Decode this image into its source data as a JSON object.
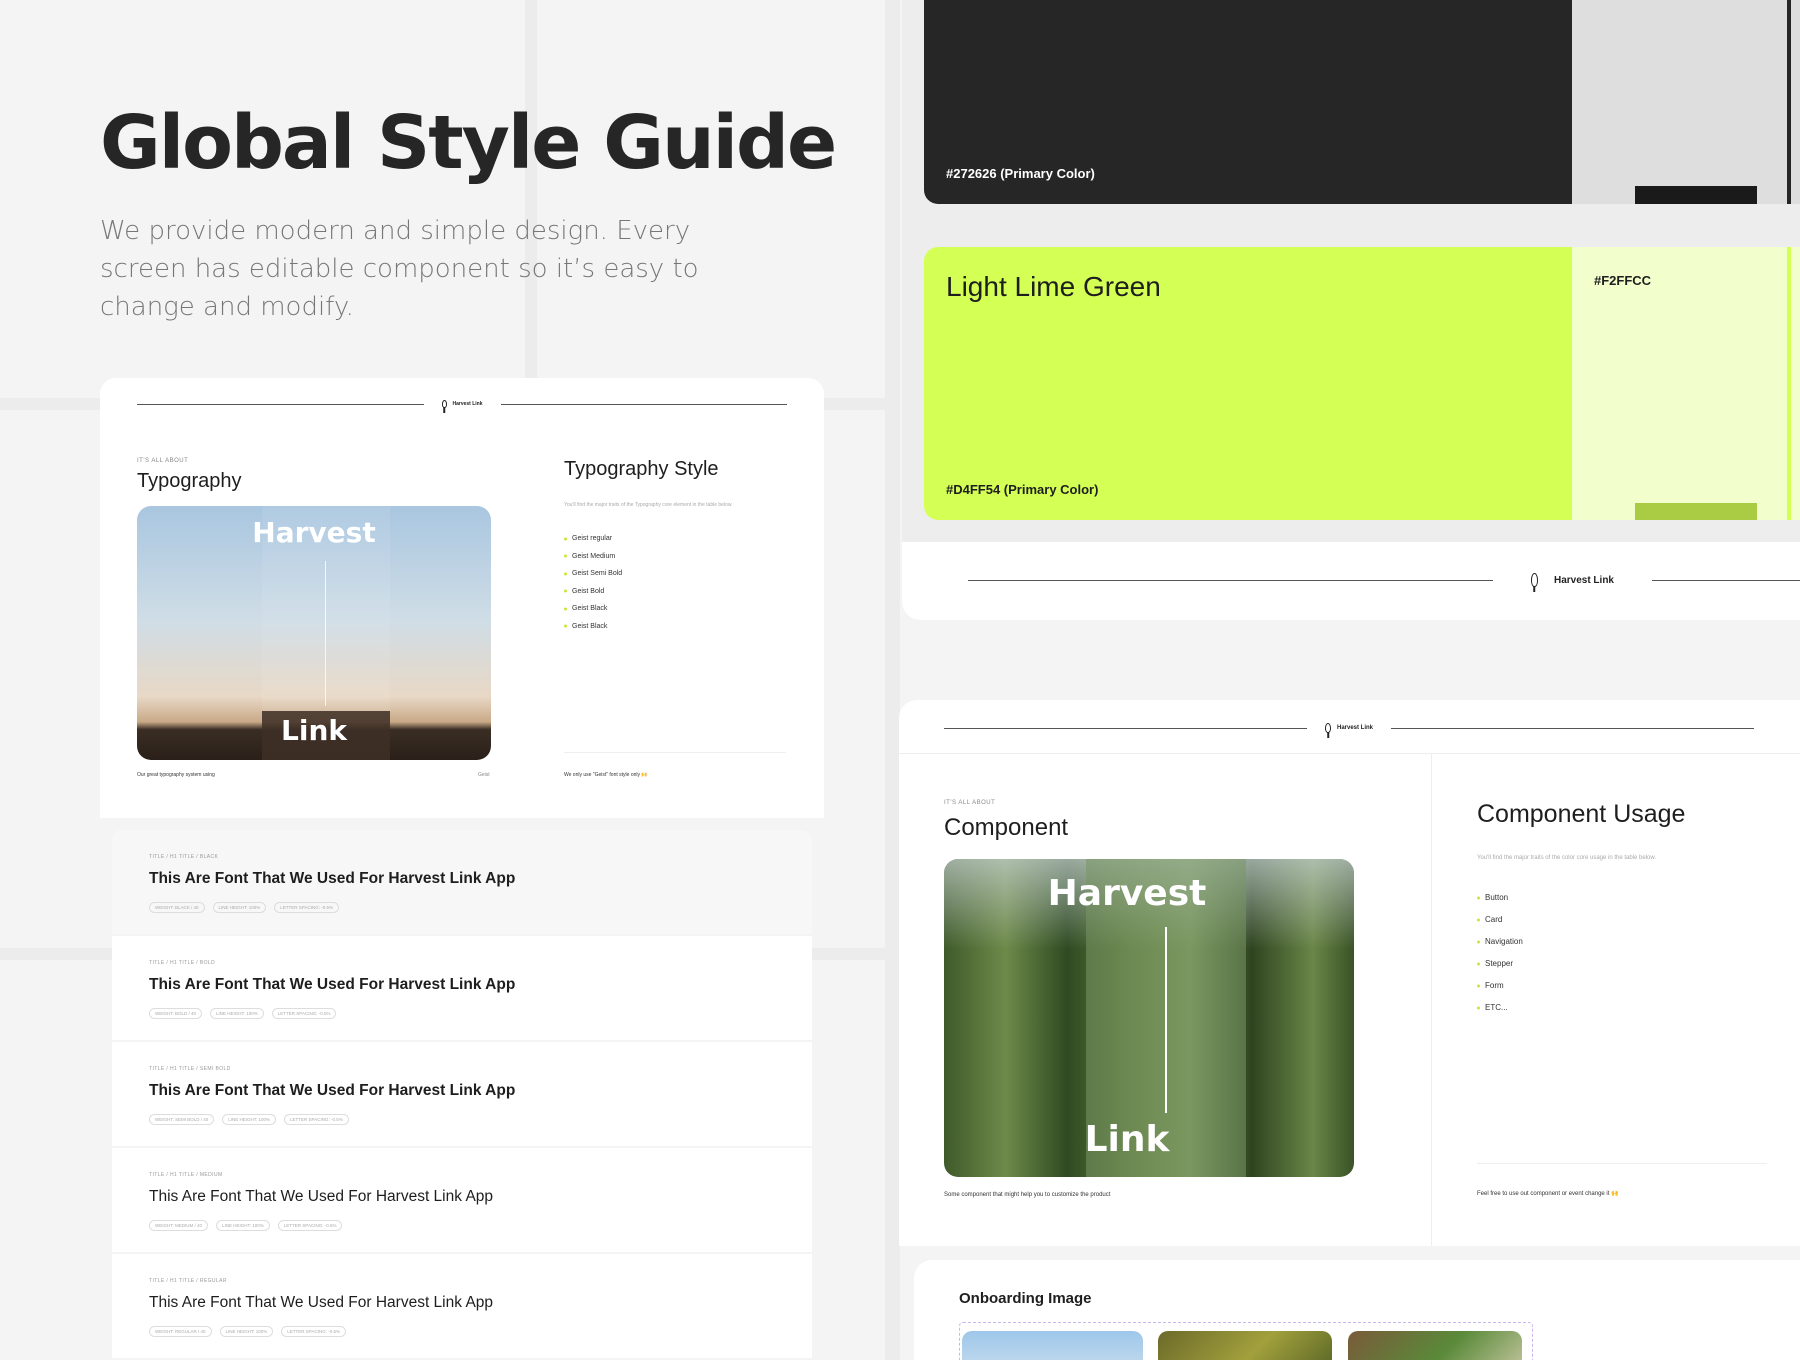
{
  "header": {
    "title": "Global Style Guide",
    "subtitle": "We provide modern and simple design. Every screen has editable component so it’s easy to change and modify."
  },
  "brand": {
    "name": "Harvest Link"
  },
  "typography_card": {
    "eyebrow": "IT'S ALL ABOUT",
    "title": "Typography",
    "photo_top": "Harvest",
    "photo_bottom": "Link",
    "caption_left": "Our great typography system using",
    "caption_right": "Geist",
    "style_title": "Typography Style",
    "style_desc": "You'll find the major traits of the Typography core element in the table below.",
    "items": [
      "Geist regular",
      "Geist Medium",
      "Geist Semi Bold",
      "Geist Bold",
      "Geist Black",
      "Geist Black"
    ],
    "footer_note": "We only use \"Geist\" font style only 🙌"
  },
  "font_rows": [
    {
      "cap": "TITLE / H1 TITLE / BLACK",
      "sample": "This Are Font That We Used For Harvest Link App",
      "tags": [
        "WEIGHT: BLACK / 40",
        "LINE HEIGHT: 100%",
        "LETTER SPACING: -0.5%"
      ],
      "weight": 800
    },
    {
      "cap": "TITLE / H1 TITLE / BOLD",
      "sample": "This Are Font That We Used For Harvest Link App",
      "tags": [
        "WEIGHT: BOLD / 40",
        "LINE HEIGHT: 100%",
        "LETTER SPACING: -0.5%"
      ],
      "weight": 700
    },
    {
      "cap": "TITLE / H1 TITLE / SEMI BOLD",
      "sample": "This Are Font That We Used For Harvest Link App",
      "tags": [
        "WEIGHT: SEMI BOLD / 40",
        "LINE HEIGHT: 100%",
        "LETTER SPACING: -0.5%"
      ],
      "weight": 600
    },
    {
      "cap": "TITLE / H1 TITLE / MEDIUM",
      "sample": "This Are Font That We Used For Harvest Link App",
      "tags": [
        "WEIGHT: MEDIUM / 40",
        "LINE HEIGHT: 100%",
        "LETTER SPACING: -0.5%"
      ],
      "weight": 500
    },
    {
      "cap": "TITLE / H1 TITLE / REGULAR",
      "sample": "This Are Font That We Used For Harvest Link App",
      "tags": [
        "WEIGHT: REGULAR / 40",
        "LINE HEIGHT: 100%",
        "LETTER SPACING: -0.5%"
      ],
      "weight": 400
    }
  ],
  "colors": {
    "primary_label": "#272626 (Primary Color)",
    "primary_hex": "#272626",
    "lime_name": "Light Lime Green",
    "lime_label": "#D4FF54 (Primary Color)",
    "lime_hex": "#D4FF54",
    "lime_light_label": "#F2FFCC",
    "lime_light_hex": "#F2FFCC"
  },
  "component_card": {
    "eyebrow": "IT'S ALL ABOUT",
    "title": "Component",
    "photo_top": "Harvest",
    "photo_bottom": "Link",
    "caption": "Some component that might help you to customize the product",
    "usage_title": "Component Usage",
    "usage_desc": "You'll find the major traits of the color core usage in the table below.",
    "items": [
      "Button",
      "Card",
      "Navigation",
      "Stepper",
      "Form",
      "ETC..."
    ],
    "footer_note": "Feel free to use out component or event change it 🙌"
  },
  "onboarding": {
    "title": "Onboarding Image"
  }
}
